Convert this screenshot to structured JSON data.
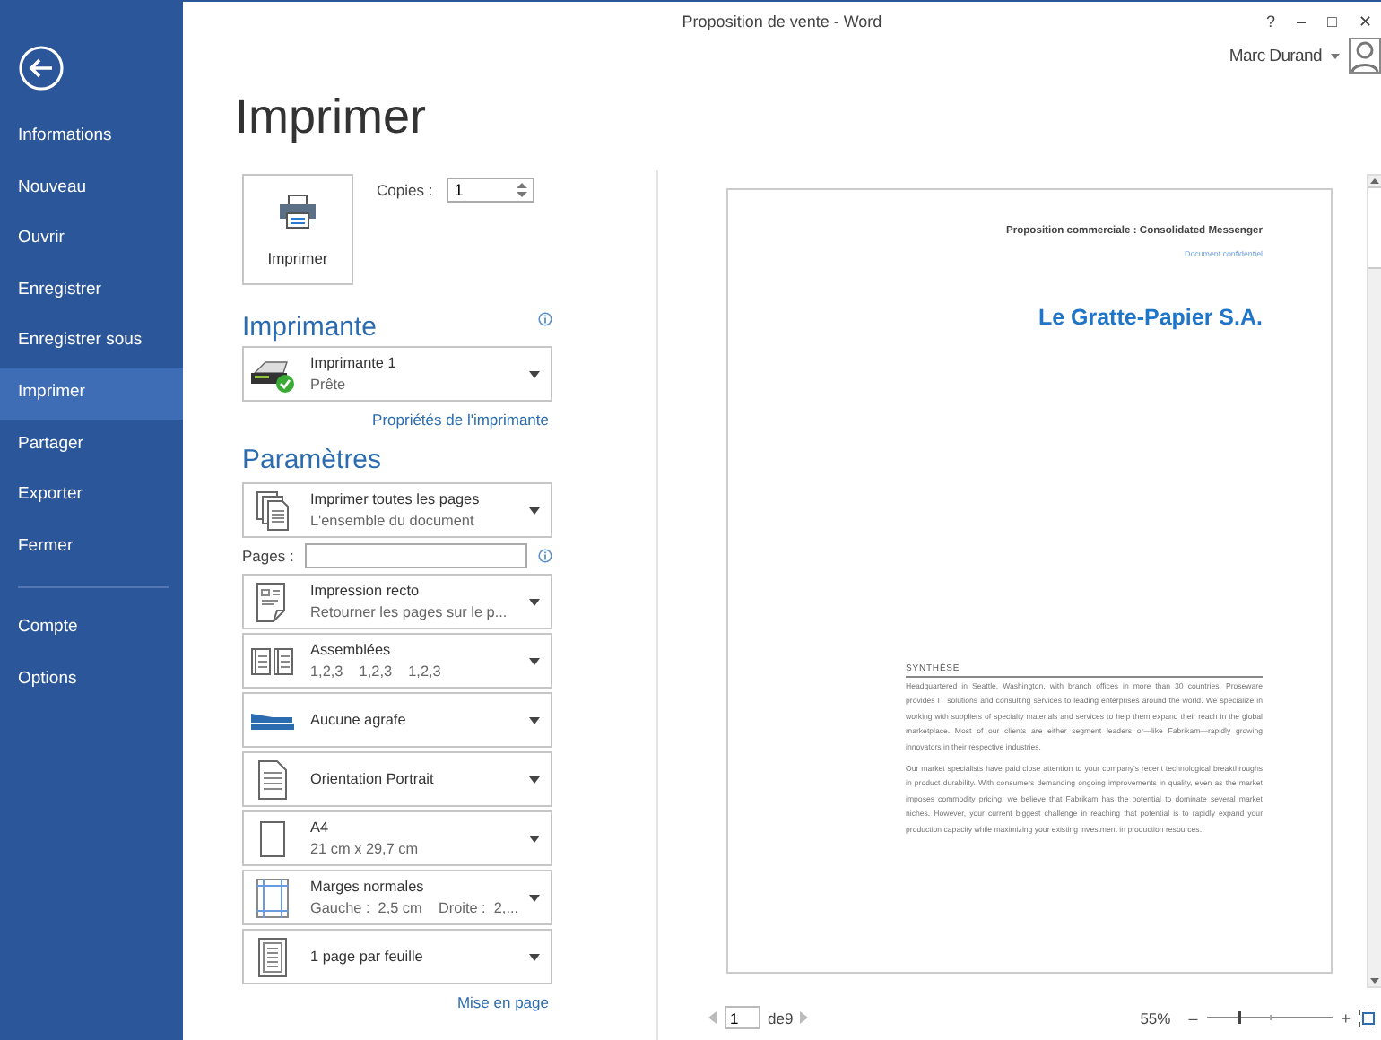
{
  "window": {
    "title": "Proposition de vente - Word",
    "controls": [
      "?",
      "–",
      "□",
      "✕"
    ],
    "user": "Marc Durand"
  },
  "sidebar": {
    "items": [
      {
        "label": "Informations",
        "selected": false
      },
      {
        "label": "Nouveau",
        "selected": false
      },
      {
        "label": "Ouvrir",
        "selected": false
      },
      {
        "label": "Enregistrer",
        "selected": false
      },
      {
        "label": "Enregistrer sous",
        "selected": false
      },
      {
        "label": "Imprimer",
        "selected": true
      },
      {
        "label": "Partager",
        "selected": false
      },
      {
        "label": "Exporter",
        "selected": false
      },
      {
        "label": "Fermer",
        "selected": false
      }
    ],
    "lower_items": [
      {
        "label": "Compte",
        "selected": false
      },
      {
        "label": "Options",
        "selected": false
      }
    ]
  },
  "heading": "Imprimer",
  "print_button": "Imprimer",
  "copies": {
    "label": "Copies :",
    "value": "1"
  },
  "printer": {
    "heading": "Imprimante",
    "name": "Imprimante 1",
    "status": "Prête",
    "link": "Propriétés de l'imprimante"
  },
  "settings": {
    "heading": "Paramètres",
    "pages_label": "Pages :",
    "options": [
      {
        "title": "Imprimer toutes les pages",
        "subtitle": "L'ensemble du document"
      },
      {
        "title": "Impression recto",
        "subtitle": "Retourner les pages sur le p..."
      },
      {
        "title": "Assemblées",
        "subtitle": "1,2,3    1,2,3    1,2,3"
      },
      {
        "title": "Aucune agrafe"
      },
      {
        "title": "Orientation Portrait"
      },
      {
        "title": "A4",
        "subtitle": "21 cm x 29,7 cm"
      },
      {
        "title": "Marges normales",
        "subtitle": "Gauche :  2,5 cm    Droite :  2,..."
      },
      {
        "title": "1 page par feuille"
      }
    ],
    "link": "Mise en page"
  },
  "preview": {
    "header": "Proposition commerciale : Consolidated Messenger",
    "subheader": "Document confidentiel",
    "title": "Le Gratte-Papier S.A.",
    "section": "SYNTHÈSE",
    "paragraphs": [
      "Headquartered in Seattle, Washington, with branch offices in more than 30 countries, Proseware provides IT solutions and consulting services to leading enterprises around the world. We specialize in working with suppliers of specialty materials and services to help them expand their reach in the global marketplace. Most of our clients are either segment leaders or—like Fabrikam—rapidly growing innovators in their respective industries.",
      "Our market specialists have paid close attention to your company's recent technological breakthroughs in product durability. With consumers demanding ongoing improvements in quality, even as the market imposes commodity pricing, we believe that Fabrikam has the potential to dominate several market niches. However, your current biggest challenge in reaching that potential is to rapidly expand your production capacity while maximizing your existing investment in production resources."
    ]
  },
  "pager": {
    "page": "1",
    "of": "de9"
  },
  "zoom": {
    "reading": "55%",
    "level": 0.26,
    "minus": "–",
    "plus": "+"
  }
}
